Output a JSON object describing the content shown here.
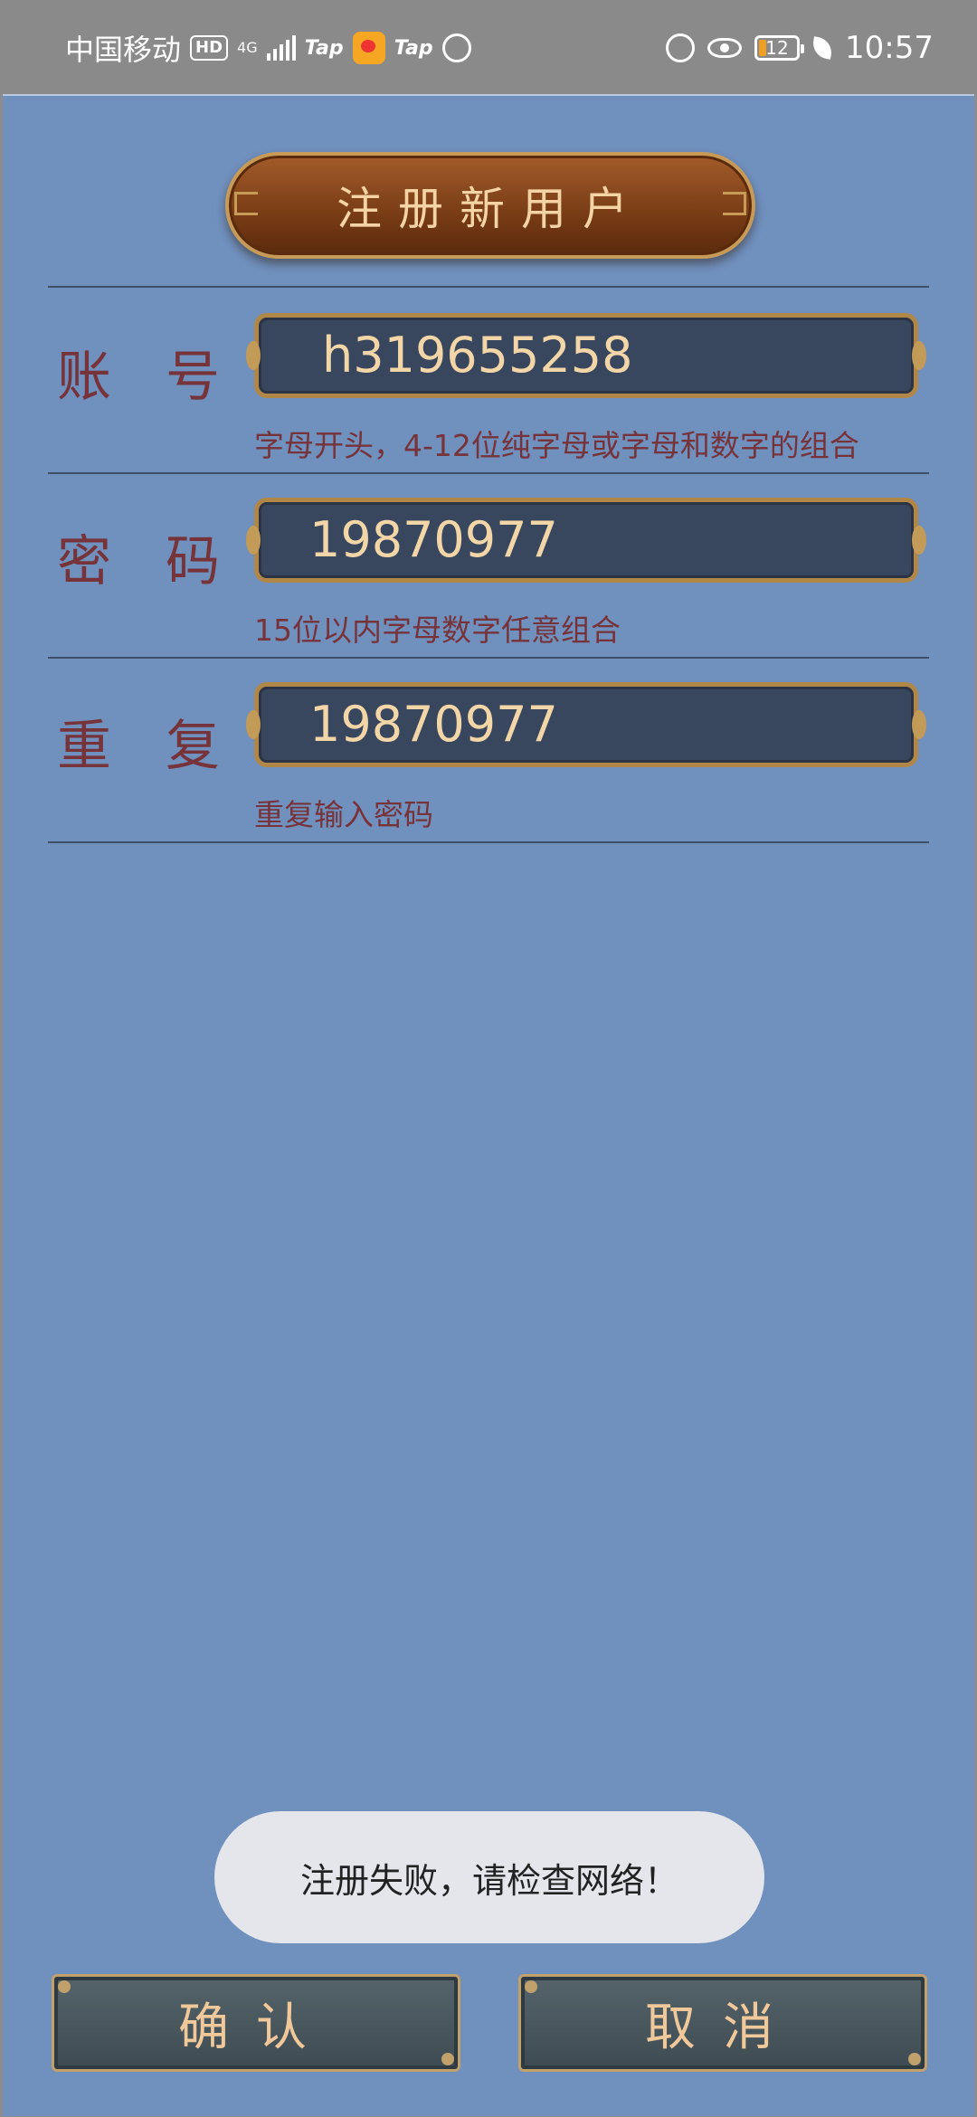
{
  "status_bar": {
    "carrier": "中国移动",
    "hd_badge": "HD",
    "network": "4G",
    "tap_1": "Tap",
    "tap_2": "Tap",
    "battery_level": "12",
    "time": "10:57"
  },
  "header": {
    "title": "注册新用户"
  },
  "form": {
    "account": {
      "label_1": "账",
      "label_2": "号",
      "value": "h319655258",
      "hint": "字母开头，4-12位纯字母或字母和数字的组合"
    },
    "password": {
      "label_1": "密",
      "label_2": "码",
      "value": "19870977",
      "hint": "15位以内字母数字任意组合"
    },
    "repeat": {
      "label_1": "重",
      "label_2": "复",
      "value": "19870977",
      "hint": "重复输入密码"
    }
  },
  "toast": {
    "message": "注册失败，请检查网络！"
  },
  "buttons": {
    "confirm": "确认",
    "cancel": "取消"
  },
  "colors": {
    "panel_bg": "#7090be",
    "label_text": "#76333a",
    "field_bg": "#38475d",
    "field_text": "#f3d6a8"
  }
}
